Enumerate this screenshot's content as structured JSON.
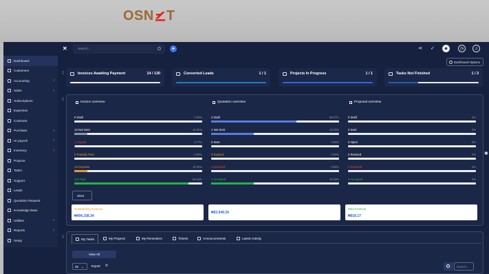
{
  "brand": {
    "logo_text": "OSNET"
  },
  "topbar": {
    "search_placeholder": "Search..."
  },
  "sidebar": {
    "items": [
      {
        "label": "Dashboard",
        "icon": "home-icon",
        "chevron": false
      },
      {
        "label": "Customers",
        "icon": "users-icon",
        "chevron": false
      },
      {
        "label": "Accounting",
        "icon": "dollar-icon",
        "chevron": true
      },
      {
        "label": "Sales",
        "icon": "cart-icon",
        "chevron": true
      },
      {
        "label": "Subscriptions",
        "icon": "refresh-icon",
        "chevron": false
      },
      {
        "label": "Expenses",
        "icon": "receipt-icon",
        "chevron": false
      },
      {
        "label": "Contracts",
        "icon": "file-icon",
        "chevron": false
      },
      {
        "label": "Purchase",
        "icon": "bag-icon",
        "chevron": true
      },
      {
        "label": "Hr payroll",
        "icon": "user-icon",
        "chevron": true
      },
      {
        "label": "Inventory",
        "icon": "box-icon",
        "chevron": true
      },
      {
        "label": "Projects",
        "icon": "folder-icon",
        "chevron": false
      },
      {
        "label": "Tasks",
        "icon": "check-icon",
        "chevron": false
      },
      {
        "label": "Support",
        "icon": "lifebuoy-icon",
        "chevron": false
      },
      {
        "label": "Leads",
        "icon": "phone-icon",
        "chevron": false
      },
      {
        "label": "Quotation Request",
        "icon": "document-icon",
        "chevron": false
      },
      {
        "label": "Knowledge Base",
        "icon": "book-icon",
        "chevron": false
      },
      {
        "label": "Utilities",
        "icon": "tools-icon",
        "chevron": true
      },
      {
        "label": "Reports",
        "icon": "chart-icon",
        "chevron": true
      },
      {
        "label": "Setup",
        "icon": "gear-icon",
        "chevron": false
      }
    ]
  },
  "dashboard_options_label": "Dashboard Options",
  "cards": [
    {
      "title": "Invoices Awaiting Payment",
      "count": "14 / 130",
      "fill": 0.11,
      "color": "#ffffff"
    },
    {
      "title": "Converted Leads",
      "count": "1 / 1",
      "fill": 1.0,
      "color": "#1f7fc4"
    },
    {
      "title": "Projects In Progress",
      "count": "1 / 1",
      "fill": 1.0,
      "color": "#2f66e0"
    },
    {
      "title": "Tasks Not Finished",
      "count": "1 / 3",
      "fill": 0.33,
      "color": "#1f5fa8"
    }
  ],
  "overview": {
    "invoice": {
      "title": "Invoice overview",
      "rows": [
        {
          "label": "0 Draft",
          "pct": "0.00%",
          "fill": 0.0,
          "color": "#ffffff",
          "bar": "#8b95b1"
        },
        {
          "label": "13 Not Sent",
          "pct": "10.00%",
          "fill": 0.1,
          "color": "#ffffff",
          "bar": "#8b95b1"
        },
        {
          "label": "1 Unpaid",
          "pct": "0.77%",
          "fill": 0.0077,
          "color": "#e0453a",
          "bar": "#e0453a"
        },
        {
          "label": "0 Partially Paid",
          "pct": "0.00%",
          "fill": 0.0,
          "color": "#e39b2d",
          "bar": "#e39b2d"
        },
        {
          "label": "13 Overdue",
          "pct": "10.00%",
          "fill": 0.1,
          "color": "#e39b2d",
          "bar": "#e39b2d"
        },
        {
          "label": "116 Paid",
          "pct": "89.23%",
          "fill": 0.8923,
          "color": "#27b04a",
          "bar": "#27b04a"
        }
      ]
    },
    "quotation": {
      "title": "Quotation overview",
      "rows": [
        {
          "label": "2 Draft",
          "pct": "66.67%",
          "fill": 0.6667,
          "color": "#ffffff",
          "bar": "#5b7be8"
        },
        {
          "label": "1 Not Sent",
          "pct": "33.33%",
          "fill": 0.3333,
          "color": "#ffffff",
          "bar": "#5b7be8"
        },
        {
          "label": "0 Sent",
          "pct": "0.00%",
          "fill": 0.0,
          "color": "#ffffff",
          "bar": "#8b95b1"
        },
        {
          "label": "0 Expired",
          "pct": "0.00%",
          "fill": 0.0,
          "color": "#e39b2d",
          "bar": "#e39b2d"
        },
        {
          "label": "0 Declined",
          "pct": "0.00%",
          "fill": 0.0,
          "color": "#e0453a",
          "bar": "#e0453a"
        },
        {
          "label": "1 Accepted",
          "pct": "33.33%",
          "fill": 0.3333,
          "color": "#27b04a",
          "bar": "#27b04a"
        }
      ]
    },
    "proposal": {
      "title": "Proposal overview",
      "rows": [
        {
          "label": "0 Draft",
          "pct": "0%",
          "fill": 0.0,
          "color": "#ffffff",
          "bar": "#8b95b1"
        },
        {
          "label": "0 Sent",
          "pct": "0%",
          "fill": 0.0,
          "color": "#ffffff",
          "bar": "#8b95b1"
        },
        {
          "label": "0 Open",
          "pct": "0%",
          "fill": 0.0,
          "color": "#ffffff",
          "bar": "#8b95b1"
        },
        {
          "label": "0 Revised",
          "pct": "0%",
          "fill": 0.0,
          "color": "#ffffff",
          "bar": "#8b95b1"
        },
        {
          "label": "0 Declined",
          "pct": "0%",
          "fill": 0.0,
          "color": "#e0453a",
          "bar": "#e0453a"
        },
        {
          "label": "0 Accepted",
          "pct": "0%",
          "fill": 0.0,
          "color": "#27b04a",
          "bar": "#27b04a"
        }
      ]
    }
  },
  "year_select": "2024",
  "totals": [
    {
      "label": "Outstanding Invoices",
      "label_color": "#e39b2d",
      "value": "₦494,158.34"
    },
    {
      "label": "",
      "label_color": "#8b95b1",
      "value": "₦93,949.34"
    },
    {
      "label": "Paid Invoices",
      "label_color": "#27b04a",
      "value": "₦918.17"
    }
  ],
  "tabs": [
    {
      "label": "My Tasks",
      "icon": "list-icon"
    },
    {
      "label": "My Projects",
      "icon": "folder-icon"
    },
    {
      "label": "My Reminders",
      "icon": "clock-icon"
    },
    {
      "label": "Tickets",
      "icon": "ticket-icon"
    },
    {
      "label": "Announcements",
      "icon": "megaphone-icon"
    },
    {
      "label": "Latest Activity",
      "icon": "activity-icon"
    }
  ],
  "tasks": {
    "view_all_label": "View All",
    "per_page": "25",
    "export_label": "Export",
    "search_placeholder": "Search..."
  }
}
